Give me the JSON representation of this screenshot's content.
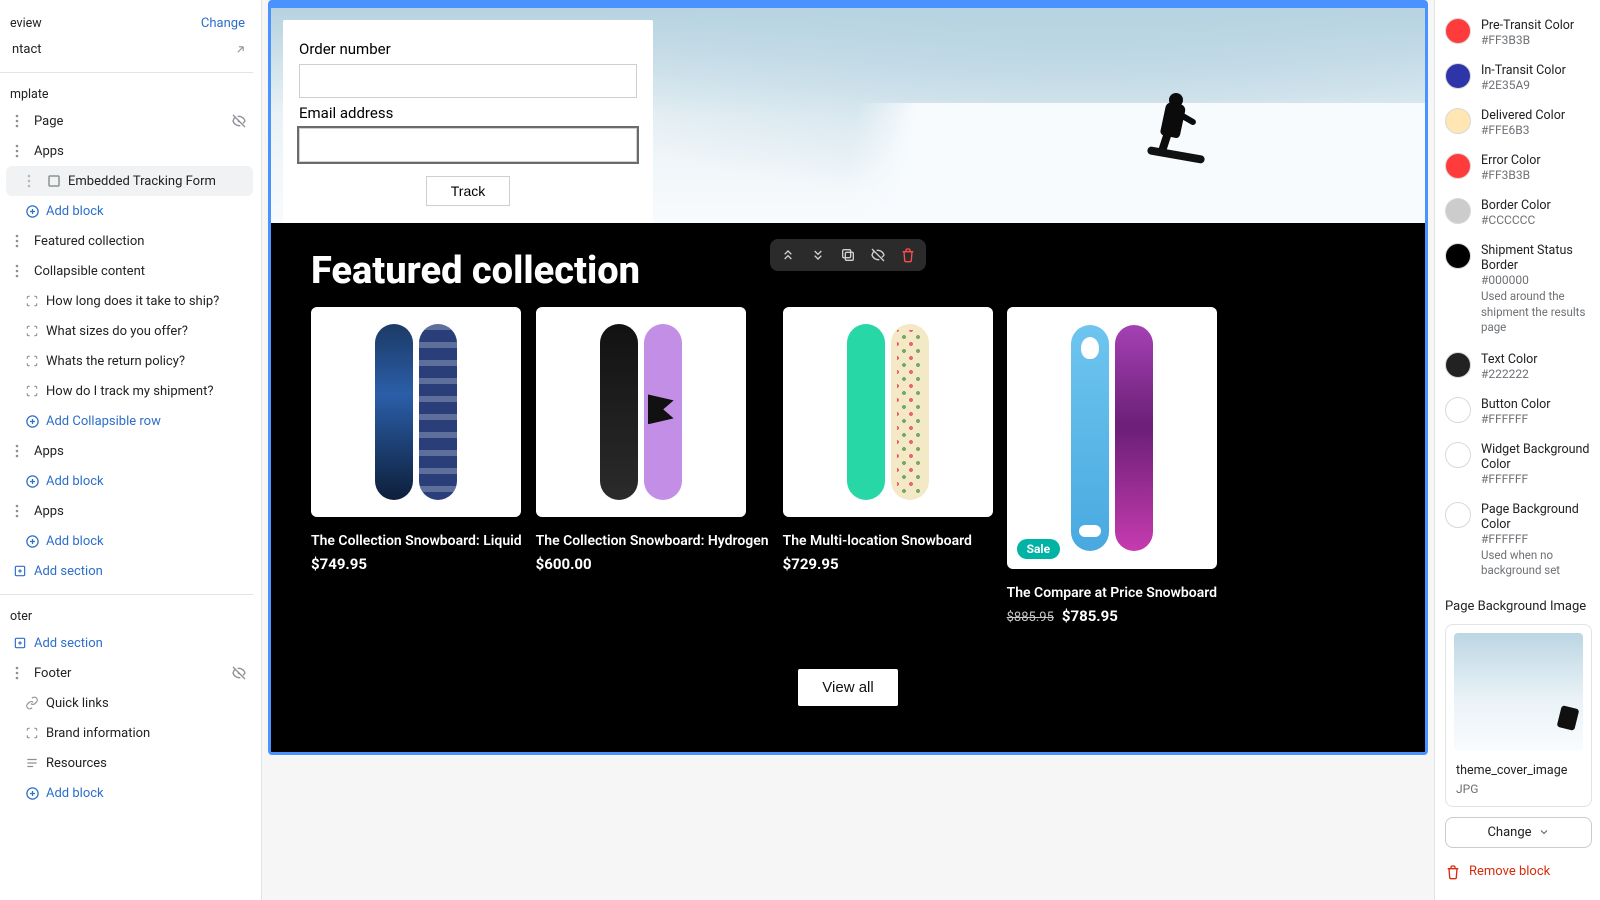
{
  "left": {
    "top": {
      "preview": "eview",
      "contact": "ntact",
      "change": "Change"
    },
    "template_heading": "mplate",
    "items_template": [
      {
        "label": "Page",
        "hidden": true
      },
      {
        "label": "Apps"
      },
      {
        "label": "Embedded Tracking Form",
        "selected": true,
        "nested": true
      }
    ],
    "add_block": "Add block",
    "featured_collection": "Featured collection",
    "collapsible_content": "Collapsible content",
    "faq": [
      "How long does it take to ship?",
      "What sizes do you offer?",
      "Whats the return policy?",
      "How do I track my shipment?"
    ],
    "add_collapsible_row": "Add Collapsible row",
    "apps2": "Apps",
    "apps3": "Apps",
    "add_section": "Add section",
    "footer_heading": "oter",
    "footer_items": [
      {
        "label": "Footer",
        "icon": "drag",
        "hidden": true
      },
      {
        "label": "Quick links",
        "icon": "link"
      },
      {
        "label": "Brand information",
        "icon": "bracket"
      },
      {
        "label": "Resources",
        "icon": "lines"
      }
    ]
  },
  "preview": {
    "form": {
      "order_label": "Order number",
      "email_label": "Email address",
      "track": "Track"
    },
    "featured_title": "Featured collection",
    "products": [
      {
        "title": "The Collection Snowboard: Liquid",
        "price": "$749.95"
      },
      {
        "title": "The Collection Snowboard: Hydrogen",
        "price": "$600.00"
      },
      {
        "title": "The Multi-location Snowboard",
        "price": "$729.95"
      },
      {
        "title": "The Compare at Price Snowboard",
        "compare": "$885.95",
        "price": "$785.95",
        "sale": "Sale"
      }
    ],
    "view_all": "View all"
  },
  "right": {
    "colors": [
      {
        "name": "Pre-Transit Color",
        "hex": "#FF3B3B",
        "swatch": "#FF3B3B"
      },
      {
        "name": "In-Transit Color",
        "hex": "#2E35A9",
        "swatch": "#2E35A9"
      },
      {
        "name": "Delivered Color",
        "hex": "#FFE6B3",
        "swatch": "#FFE6B3"
      },
      {
        "name": "Error Color",
        "hex": "#FF3B3B",
        "swatch": "#FF3B3B"
      },
      {
        "name": "Border Color",
        "hex": "#CCCCCC",
        "swatch": "#CCCCCC"
      },
      {
        "name": "Shipment Status Border",
        "hex": "#000000",
        "swatch": "#000000",
        "desc": "Used around the shipment the results page"
      },
      {
        "name": "Text Color",
        "hex": "#222222",
        "swatch": "#222222"
      },
      {
        "name": "Button Color",
        "hex": "#FFFFFF",
        "swatch": "#FFFFFF"
      },
      {
        "name": "Widget Background Color",
        "hex": "#FFFFFF",
        "swatch": "#FFFFFF"
      },
      {
        "name": "Page Background Color",
        "hex": "#FFFFFF",
        "swatch": "#FFFFFF",
        "desc": "Used when no background set"
      }
    ],
    "bg_heading": "Page Background Image",
    "file_name": "theme_cover_image",
    "file_type": "JPG",
    "change": "Change",
    "remove": "Remove block"
  }
}
